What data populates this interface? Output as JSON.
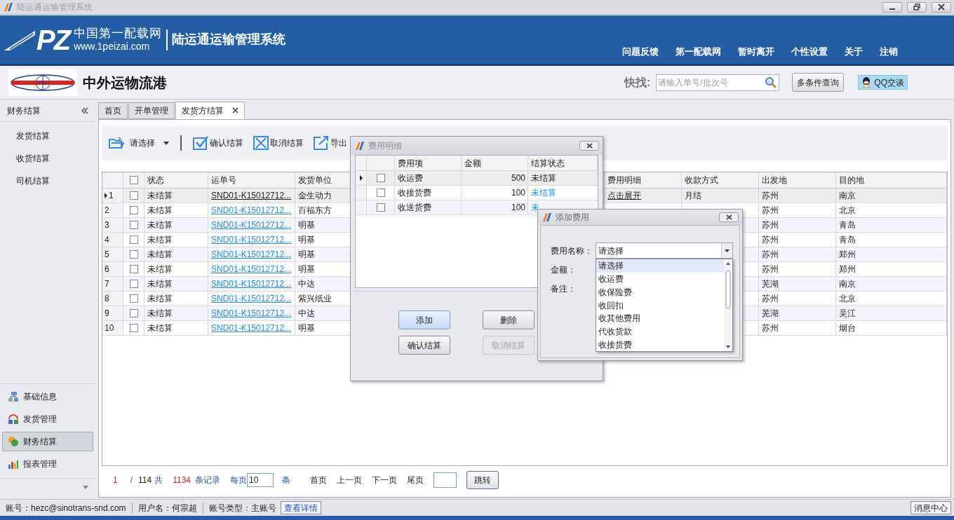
{
  "window": {
    "title": "陆运通运输管理系统"
  },
  "header": {
    "logo_mark": "PZ",
    "site_name": "中国第一配载网",
    "site_url": "www.1peizai.com",
    "system_name": "陆运通运输管理系统",
    "nav": [
      "问题反馈",
      "第一配载网",
      "暂时离开",
      "个性设置",
      "关于",
      "注销"
    ]
  },
  "company": {
    "name": "中外运物流港"
  },
  "quick_search": {
    "label": "快找:",
    "placeholder": "请输入单号/批次号"
  },
  "header_buttons": [
    {
      "label": "多条件查询",
      "kind": "plain"
    },
    {
      "label": "QQ交谈",
      "kind": "qq"
    }
  ],
  "sidebar": {
    "title": "财务结算",
    "items": [
      "发货结算",
      "收货结算",
      "司机结算"
    ],
    "modules": [
      {
        "label": "基础信息",
        "selected": false
      },
      {
        "label": "发货管理",
        "selected": false
      },
      {
        "label": "财务结算",
        "selected": true
      },
      {
        "label": "报表管理",
        "selected": false
      }
    ]
  },
  "tabs": [
    {
      "label": "首页",
      "selected": false,
      "closable": false
    },
    {
      "label": "开单管理",
      "selected": false,
      "closable": false
    },
    {
      "label": "发货方结算",
      "selected": true,
      "closable": true
    }
  ],
  "toolbar": {
    "dropdown": "请选择",
    "buttons": [
      "确认结算",
      "取消结算",
      "导出"
    ]
  },
  "table": {
    "header_checked": false,
    "columns": [
      {
        "label": "状态",
        "kind": "text"
      },
      {
        "label": "运单号",
        "kind": "link"
      },
      {
        "label": "发货单位",
        "kind": "text"
      },
      {
        "label": "费用明细",
        "kind": "link"
      },
      {
        "label": "收款方式",
        "kind": "text"
      },
      {
        "label": "出发地",
        "kind": "text"
      },
      {
        "label": "目的地",
        "kind": "text"
      }
    ],
    "rows": [
      {
        "number": "1",
        "selected": true,
        "checked": false,
        "cells": [
          "未结算",
          "SND01-K15012712...",
          "金生动力",
          "点击展开",
          "月结",
          "苏州",
          "南京"
        ]
      },
      {
        "number": "2",
        "selected": false,
        "checked": false,
        "cells": [
          "未结算",
          "SND01-K15012712...",
          "百福东方",
          null,
          null,
          "苏州",
          "北京"
        ]
      },
      {
        "number": "3",
        "selected": false,
        "checked": false,
        "cells": [
          "未结算",
          "SND01-K15012712...",
          "明基",
          null,
          null,
          "苏州",
          "青岛"
        ]
      },
      {
        "number": "4",
        "selected": false,
        "checked": false,
        "cells": [
          "未结算",
          "SND01-K15012712...",
          "明基",
          null,
          null,
          "苏州",
          "青岛"
        ]
      },
      {
        "number": "5",
        "selected": false,
        "checked": false,
        "cells": [
          "未结算",
          "SND01-K15012712...",
          "明基",
          null,
          null,
          "苏州",
          "郑州"
        ]
      },
      {
        "number": "6",
        "selected": false,
        "checked": false,
        "cells": [
          "未结算",
          "SND01-K15012712...",
          "明基",
          null,
          null,
          "苏州",
          "郑州"
        ]
      },
      {
        "number": "7",
        "selected": false,
        "checked": false,
        "cells": [
          "未结算",
          "SND01-K15012712...",
          "中达",
          null,
          null,
          "芜湖",
          "南京"
        ]
      },
      {
        "number": "8",
        "selected": false,
        "checked": false,
        "cells": [
          "未结算",
          "SND01-K15012712...",
          "紫兴纸业",
          null,
          null,
          "苏州",
          "北京"
        ]
      },
      {
        "number": "9",
        "selected": false,
        "checked": false,
        "cells": [
          "未结算",
          "SND01-K15012712...",
          "中达",
          null,
          null,
          "芜湖",
          "吴江"
        ]
      },
      {
        "number": "10",
        "selected": false,
        "checked": false,
        "cells": [
          "未结算",
          "SND01-K15012712...",
          "明基",
          null,
          null,
          "苏州",
          "烟台"
        ]
      }
    ]
  },
  "pager": {
    "page": "1",
    "separator": "/",
    "total_pages": "114",
    "total_prefix": "共",
    "records": "1134",
    "records_suffix": "条记录",
    "per_page_label": "每页",
    "per_page": "10",
    "per_page_unit": "条",
    "links": [
      "首页",
      "上一页",
      "下一页",
      "尾页"
    ],
    "jump_button": "跳转"
  },
  "fee_detail_dialog": {
    "title": "费用明细",
    "columns": [
      "费用项",
      "金额",
      "结算状态"
    ],
    "rows": [
      {
        "selected": true,
        "checked": false,
        "item": "收运费",
        "amount": "500",
        "status": "未结算"
      },
      {
        "selected": false,
        "checked": false,
        "item": "收接货费",
        "amount": "100",
        "status": "未结算"
      },
      {
        "selected": false,
        "checked": false,
        "item": "收送货费",
        "amount": "100",
        "status": "未"
      }
    ],
    "buttons": [
      {
        "label": "添加",
        "kind": "highlighted"
      },
      {
        "label": "删除",
        "kind": "normal"
      },
      {
        "label": "确认结算",
        "kind": "normal"
      },
      {
        "label": "取消结算",
        "kind": "disabled"
      }
    ]
  },
  "add_fee_dialog": {
    "title": "添加费用",
    "labels": [
      "费用名称：",
      "金额：",
      "备注："
    ],
    "combo": {
      "value": "请选择",
      "expanded": true,
      "options": [
        {
          "label": "请选择",
          "selected": true
        },
        {
          "label": "收运费",
          "selected": false
        },
        {
          "label": "收保险费",
          "selected": false
        },
        {
          "label": "收回扣",
          "selected": false
        },
        {
          "label": "收其他费用",
          "selected": false
        },
        {
          "label": "代收货款",
          "selected": false
        },
        {
          "label": "收接货费",
          "selected": false
        }
      ]
    }
  },
  "status_bar": {
    "account": "账号：hezc@sinotrans-snd.com",
    "user": "用户名：何宗超",
    "account_type": "账号类型：主账号",
    "details_button": "查看详情",
    "messages_button": "消息中心"
  }
}
